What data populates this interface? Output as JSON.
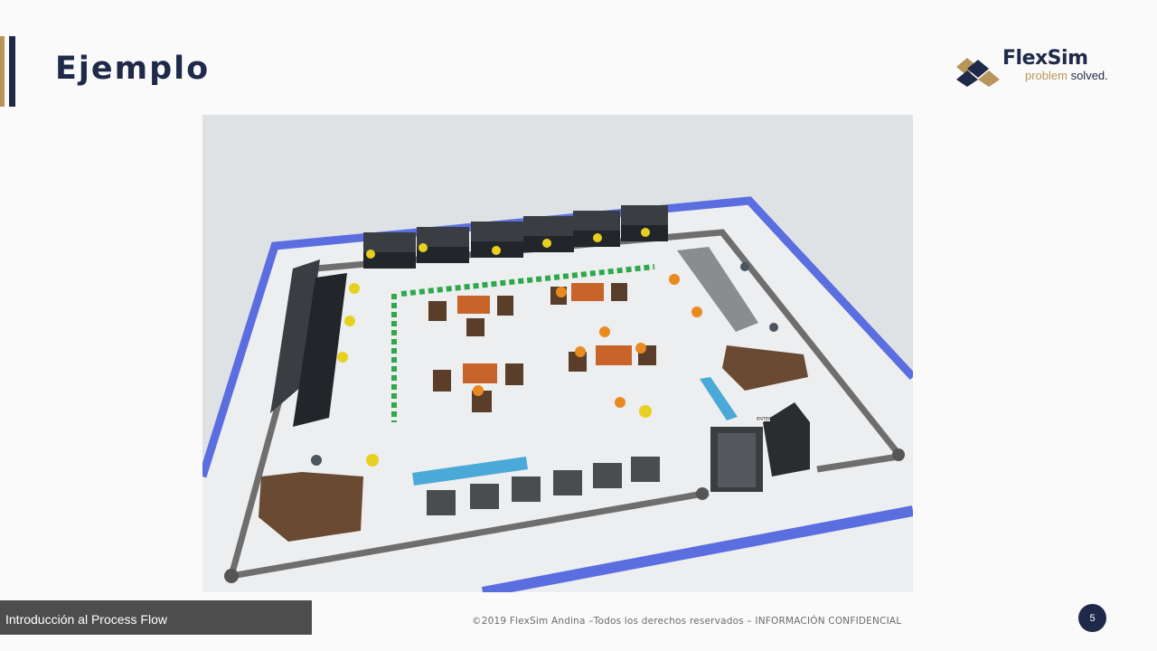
{
  "slide": {
    "title": "Ejemplo",
    "page_number": "5"
  },
  "logo": {
    "brand": "FlexSim",
    "tagline_part1": "problem",
    "tagline_part2": " solved."
  },
  "footer": {
    "section_label": "Introducción al Process Flow",
    "copyright": "©2019 FlexSim Andina –Todos los derechos reservados – INFORMACIÓN CONFIDENCIAL"
  },
  "scene": {
    "door_sign": "ENTER"
  },
  "colors": {
    "navy": "#1f2a4a",
    "gold": "#b8955a",
    "floor_border": "#5b6ee0",
    "path_gray": "#6e6e6e",
    "queue_blue": "#4aa9d6",
    "green_path": "#2ea84a",
    "workstation": "#3a3d42",
    "table_orange": "#c8642a",
    "worker_yellow": "#e8d020",
    "customer_orange": "#e88a20"
  }
}
